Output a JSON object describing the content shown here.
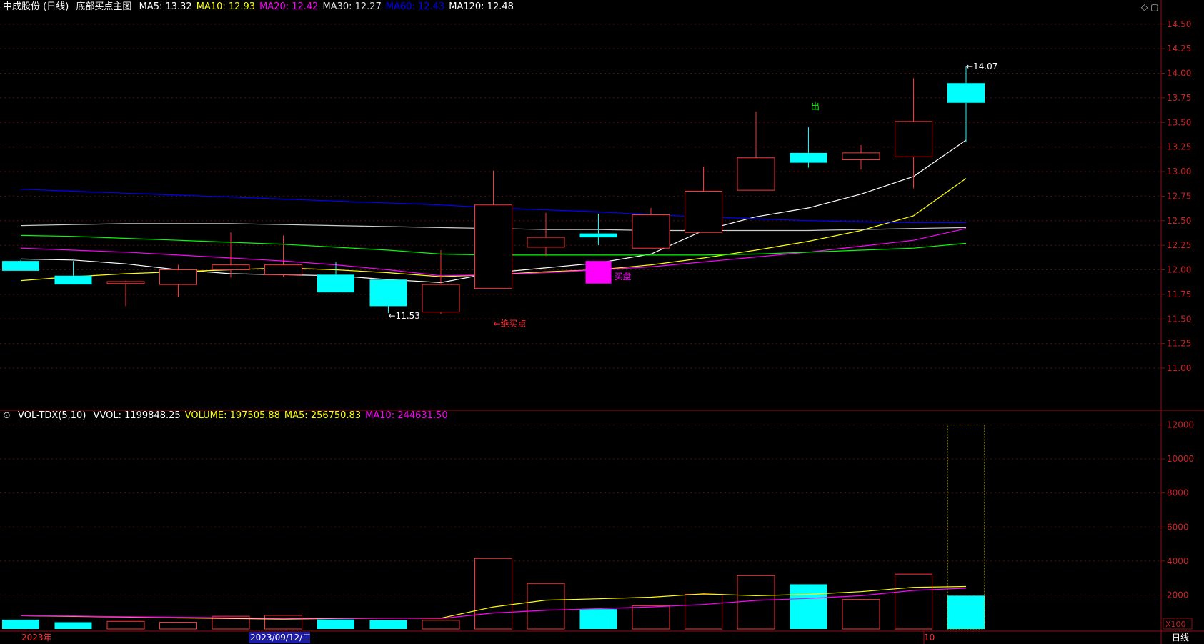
{
  "header": {
    "stock": "中成股份 (日线)",
    "indicator": "底部买点主图",
    "ma_labels": [
      {
        "text": "MA5: 13.32",
        "color": "#ffffff"
      },
      {
        "text": "MA10: 12.93",
        "color": "#ffff00"
      },
      {
        "text": "MA20: 12.42",
        "color": "#ff00ff"
      },
      {
        "text": "MA30: 12.27",
        "color": "#e0e0e0"
      },
      {
        "text": "MA60: 12.43",
        "color": "#0000ff"
      },
      {
        "text": "MA120: 12.48",
        "color": "#ffffff"
      }
    ]
  },
  "vol_header": {
    "indicator": "VOL-TDX(5,10)",
    "items": [
      {
        "text": "VVOL: 1199848.25",
        "color": "#ffffff"
      },
      {
        "text": "VOLUME: 197505.88",
        "color": "#ffff00"
      },
      {
        "text": "MA5: 256750.83",
        "color": "#ffff00"
      },
      {
        "text": "MA10: 244631.50",
        "color": "#ff00ff"
      }
    ]
  },
  "x_axis": {
    "labels": [
      {
        "text": "2023年",
        "color": "#ff3333",
        "highlight": false
      },
      {
        "text": "2023/09/12/二",
        "color": "#ffffff",
        "highlight": true
      },
      {
        "text": "10",
        "color": "#ff3333",
        "highlight": false
      }
    ],
    "period": "日线",
    "vol_unit": "X100"
  },
  "chart_data": [
    {
      "type": "candlestick",
      "y_ticks": [
        "11.00",
        "11.25",
        "11.50",
        "11.75",
        "12.00",
        "12.25",
        "12.50",
        "12.75",
        "13.00",
        "13.25",
        "13.50",
        "13.75",
        "14.00",
        "14.25",
        "14.50"
      ],
      "ylim": [
        10.6,
        14.6
      ],
      "candles": [
        {
          "o": 12.09,
          "h": 12.1,
          "l": 11.99,
          "c": 11.99
        },
        {
          "o": 11.94,
          "h": 12.09,
          "l": 11.85,
          "c": 11.85
        },
        {
          "o": 11.86,
          "h": 11.89,
          "l": 11.63,
          "c": 11.88
        },
        {
          "o": 11.85,
          "h": 12.05,
          "l": 11.72,
          "c": 12.0
        },
        {
          "o": 12.0,
          "h": 12.38,
          "l": 11.92,
          "c": 12.05
        },
        {
          "o": 11.95,
          "h": 12.35,
          "l": 11.93,
          "c": 12.05
        },
        {
          "o": 11.95,
          "h": 12.08,
          "l": 11.77,
          "c": 11.77
        },
        {
          "o": 11.9,
          "h": 11.9,
          "l": 11.56,
          "c": 11.63
        },
        {
          "o": 11.57,
          "h": 12.2,
          "l": 11.55,
          "c": 11.85
        },
        {
          "o": 11.81,
          "h": 13.01,
          "l": 11.81,
          "c": 12.66
        },
        {
          "o": 12.23,
          "h": 12.58,
          "l": 12.14,
          "c": 12.33
        },
        {
          "o": 12.37,
          "h": 12.57,
          "l": 12.25,
          "c": 12.33
        },
        {
          "o": 12.22,
          "h": 12.63,
          "l": 12.22,
          "c": 12.56
        },
        {
          "o": 12.38,
          "h": 13.05,
          "l": 12.38,
          "c": 12.8
        },
        {
          "o": 12.81,
          "h": 13.61,
          "l": 12.81,
          "c": 13.14
        },
        {
          "o": 13.19,
          "h": 13.45,
          "l": 13.04,
          "c": 13.09
        },
        {
          "o": 13.12,
          "h": 13.27,
          "l": 13.02,
          "c": 13.19
        },
        {
          "o": 13.15,
          "h": 13.95,
          "l": 12.83,
          "c": 13.51
        },
        {
          "o": 13.9,
          "h": 14.07,
          "l": 13.3,
          "c": 13.7
        }
      ],
      "ma_lines": [
        {
          "name": "MA5",
          "color": "#ffffff",
          "values": [
            12.11,
            12.1,
            12.06,
            12.0,
            11.96,
            11.95,
            11.94,
            11.9,
            11.87,
            11.97,
            12.02,
            12.07,
            12.16,
            12.4,
            12.54,
            12.63,
            12.77,
            12.95,
            13.32
          ]
        },
        {
          "name": "MA10",
          "color": "#ffff00",
          "values": [
            11.89,
            11.93,
            11.96,
            11.98,
            12.0,
            12.02,
            12.0,
            11.97,
            11.93,
            11.95,
            11.98,
            12.0,
            12.05,
            12.12,
            12.2,
            12.29,
            12.4,
            12.55,
            12.93
          ]
        },
        {
          "name": "MA20",
          "color": "#ff00ff",
          "values": [
            12.22,
            12.2,
            12.18,
            12.15,
            12.12,
            12.09,
            12.05,
            12.0,
            11.94,
            11.95,
            11.97,
            12.0,
            12.03,
            12.08,
            12.13,
            12.18,
            12.24,
            12.3,
            12.42
          ]
        },
        {
          "name": "MA30",
          "color": "#00ff00",
          "values": [
            12.35,
            12.34,
            12.32,
            12.3,
            12.28,
            12.26,
            12.23,
            12.2,
            12.16,
            12.15,
            12.15,
            12.15,
            12.15,
            12.15,
            12.16,
            12.18,
            12.2,
            12.22,
            12.27
          ]
        },
        {
          "name": "MA60",
          "color": "#0000ff",
          "values": [
            12.82,
            12.8,
            12.78,
            12.76,
            12.74,
            12.72,
            12.7,
            12.68,
            12.66,
            12.63,
            12.61,
            12.59,
            12.56,
            12.54,
            12.52,
            12.5,
            12.49,
            12.48,
            12.48
          ]
        },
        {
          "name": "MA120",
          "color": "#cccccc",
          "values": [
            12.45,
            12.46,
            12.47,
            12.47,
            12.47,
            12.46,
            12.45,
            12.44,
            12.43,
            12.42,
            12.41,
            12.41,
            12.4,
            12.4,
            12.4,
            12.4,
            12.41,
            12.42,
            12.43
          ]
        }
      ],
      "annotations": [
        {
          "text": "←11.53",
          "index": 7,
          "price": 11.53,
          "color": "#ffffff"
        },
        {
          "text": "←14.07",
          "index": 18,
          "price": 14.07,
          "color": "#ffffff"
        },
        {
          "text": "←绝买点",
          "index": 9,
          "price": 11.45,
          "color": "#ff3333"
        },
        {
          "text": "出",
          "index": 15,
          "price": 13.71,
          "color": "#00ff00",
          "vertical": true
        },
        {
          "text": "买盘",
          "index": 11,
          "price": 11.93,
          "color": "#ff00ff"
        }
      ],
      "markers": [
        {
          "index": 11,
          "top": 12.09,
          "bottom": 11.86,
          "color": "#ff00ff"
        }
      ]
    },
    {
      "type": "bar",
      "name": "VOL",
      "y_ticks": [
        "2000",
        "4000",
        "6000",
        "8000",
        "10000",
        "12000"
      ],
      "ylim": [
        0,
        12400
      ],
      "volumes": [
        550,
        400,
        450,
        400,
        750,
        800,
        560,
        510,
        510,
        4150,
        2680,
        1170,
        1370,
        2040,
        3140,
        2630,
        1740,
        3230,
        1960
      ],
      "ma5": [
        780,
        740,
        700,
        650,
        620,
        580,
        620,
        640,
        640,
        1300,
        1700,
        1780,
        1870,
        2070,
        1960,
        2040,
        2200,
        2450,
        2500
      ],
      "ma10": [
        780,
        760,
        720,
        690,
        660,
        640,
        640,
        640,
        620,
        940,
        1100,
        1200,
        1300,
        1440,
        1680,
        1800,
        1960,
        2270,
        2400
      ],
      "vvol": 12000,
      "vvol_index": 18
    }
  ]
}
